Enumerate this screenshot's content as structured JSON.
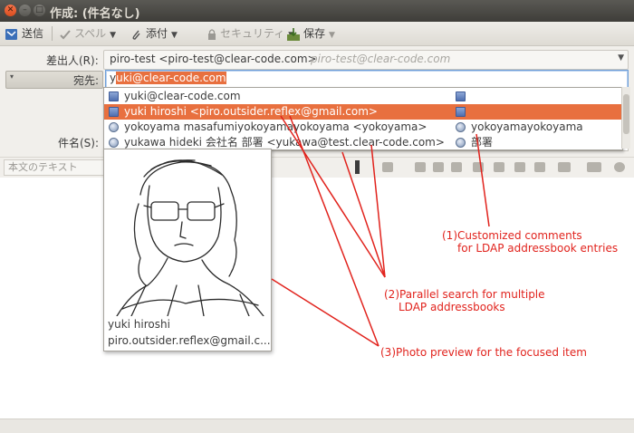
{
  "window": {
    "title": "作成: (件名なし)"
  },
  "toolbar": {
    "send": "送信",
    "spell": "スペル",
    "attach": "添付",
    "security": "セキュリティ",
    "save": "保存"
  },
  "header": {
    "from_label": "差出人(R):",
    "from_value": "piro-test <piro-test@clear-code.com>",
    "from_alias": "piro-test@clear-code.com",
    "to_label": "宛先:",
    "to_value_typed": "y",
    "to_value_completed": "uki@clear-code.com",
    "subject_label": "件名(S):"
  },
  "formatbar": {
    "body_style": "本文のテキスト"
  },
  "autocomplete": {
    "rows": [
      {
        "text": "yuki@clear-code.com",
        "comment": "",
        "icon": "card-icon",
        "comment_icon": "card-icon",
        "selected": false
      },
      {
        "text": "yuki hiroshi <piro.outsider.reflex@gmail.com>",
        "comment": "",
        "icon": "card-icon",
        "comment_icon": "card-icon",
        "selected": true
      },
      {
        "text": "yokoyama masafumiyokoyamayokoyama <yokoyama>",
        "comment": "yokoyamayokoyama",
        "icon": "ldap-icon",
        "comment_icon": "ldap-icon",
        "selected": false
      },
      {
        "text": "yukawa hideki 会社名 部署 <yukawa@test.clear-code.com>",
        "comment": "部署",
        "icon": "ldap-icon",
        "comment_icon": "ldap-icon",
        "selected": false
      }
    ]
  },
  "preview": {
    "name": "yuki hiroshi",
    "email": "piro.outsider.reflex@gmail.c..."
  },
  "annotations": {
    "a1_line1": "(1)Customized comments",
    "a1_line2": "for LDAP addressbook entries",
    "a2_line1": "(2)Parallel search for multiple",
    "a2_line2": "LDAP addressbooks",
    "a3": "(3)Photo preview for the focused item"
  },
  "colors": {
    "highlight": "#e8703f",
    "annotation": "#e1231d"
  }
}
